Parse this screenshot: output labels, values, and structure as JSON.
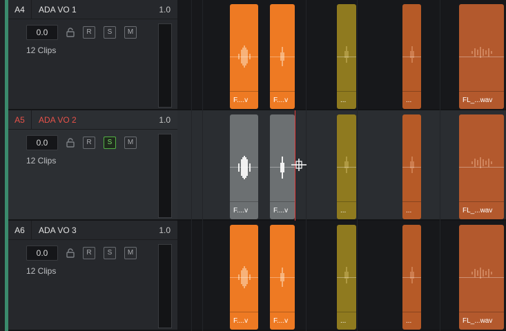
{
  "tracks": [
    {
      "id": "A4",
      "name": "ADA VO 1",
      "level": "1.0",
      "volume": "0.0",
      "buttons": [
        "R",
        "S",
        "M"
      ],
      "clips_count": "12 Clips"
    },
    {
      "id": "A5",
      "name": "ADA VO 2",
      "level": "1.0",
      "volume": "0.0",
      "buttons": [
        "R",
        "S",
        "M"
      ],
      "clips_count": "12 Clips",
      "solo_active": true
    },
    {
      "id": "A6",
      "name": "ADA VO 3",
      "level": "1.0",
      "volume": "0.0",
      "buttons": [
        "R",
        "S",
        "M"
      ],
      "clips_count": "12 Clips"
    }
  ],
  "clip_labels": {
    "short": "F....v",
    "dots": "...",
    "long": "FL_...wav"
  },
  "colors": {
    "orange": "#ee7a23",
    "gray_selected": "#6c7072",
    "olive": "#8f7a1f",
    "rust": "#b65a27",
    "selected_track_label": "#e8524a",
    "solo_active": "#53b345",
    "track_accent": "#3a8a6c",
    "playhead": "#e53a3a"
  },
  "icons": [
    "lock-icon",
    "waveform-icon",
    "crosshair-cursor-icon"
  ]
}
